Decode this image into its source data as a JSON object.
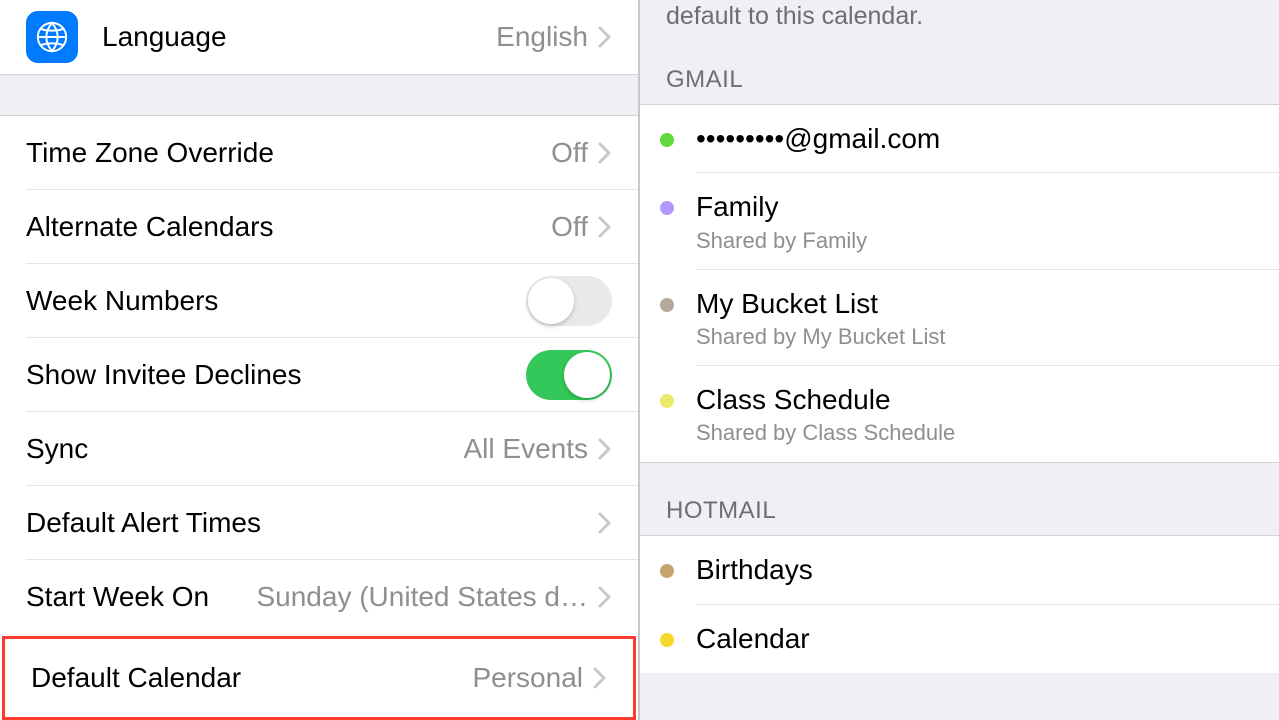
{
  "left": {
    "language": {
      "label": "Language",
      "value": "English"
    },
    "timeZoneOverride": {
      "label": "Time Zone Override",
      "value": "Off"
    },
    "alternateCalendars": {
      "label": "Alternate Calendars",
      "value": "Off"
    },
    "weekNumbers": {
      "label": "Week Numbers"
    },
    "showInviteeDeclines": {
      "label": "Show Invitee Declines"
    },
    "sync": {
      "label": "Sync",
      "value": "All Events"
    },
    "defaultAlertTimes": {
      "label": "Default Alert Times"
    },
    "startWeekOn": {
      "label": "Start Week On",
      "value": "Sunday (United States d…"
    },
    "defaultCalendar": {
      "label": "Default Calendar",
      "value": "Personal"
    }
  },
  "right": {
    "introText": "default to this calendar.",
    "sections": {
      "gmail": {
        "header": "GMAIL",
        "items": [
          {
            "title": "•••••••••@gmail.com",
            "sub": "",
            "color": "#62d93e"
          },
          {
            "title": "Family",
            "sub": "Shared by Family",
            "color": "#b197ff"
          },
          {
            "title": "My Bucket List",
            "sub": "Shared by My Bucket List",
            "color": "#b6a999"
          },
          {
            "title": "Class Schedule",
            "sub": "Shared by Class Schedule",
            "color": "#ecea6b"
          }
        ]
      },
      "hotmail": {
        "header": "HOTMAIL",
        "items": [
          {
            "title": "Birthdays",
            "sub": "",
            "color": "#c7a36f"
          },
          {
            "title": "Calendar",
            "sub": "",
            "color": "#f5d82e"
          }
        ]
      }
    }
  }
}
